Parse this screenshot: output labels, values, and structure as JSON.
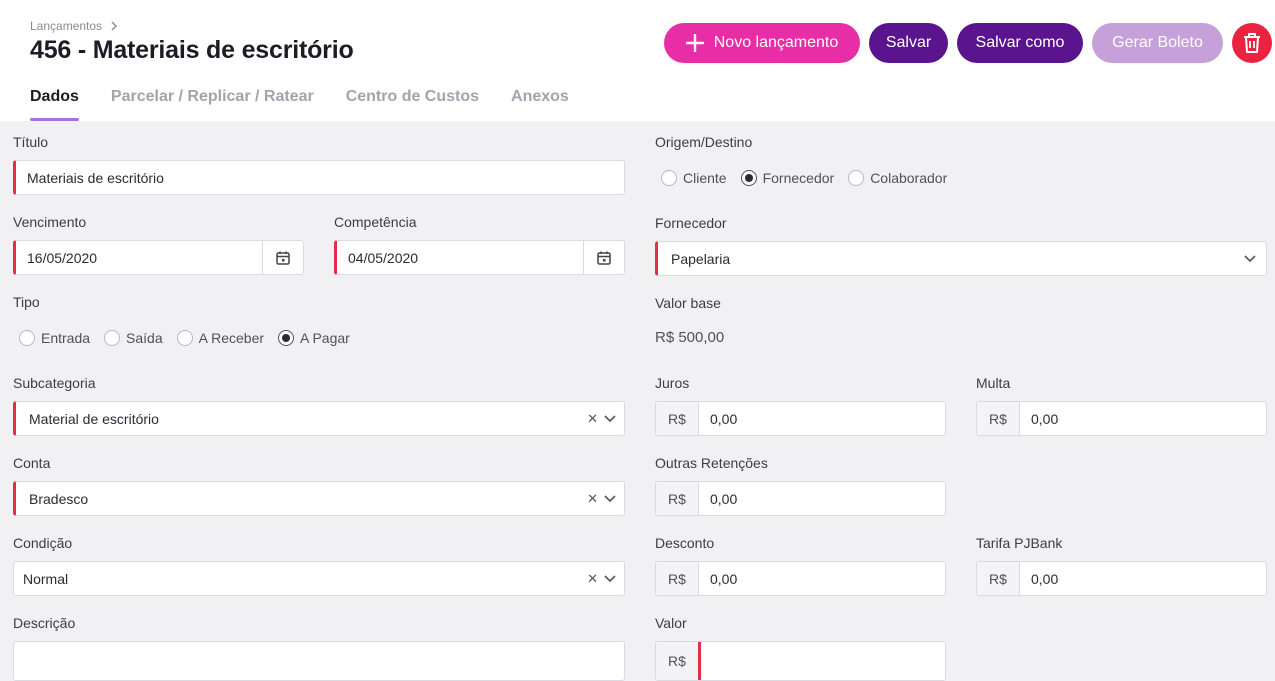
{
  "header": {
    "breadcrumb": "Lançamentos",
    "title": "456 - Materiais de escritório"
  },
  "actions": {
    "new_label": "Novo lançamento",
    "save_label": "Salvar",
    "save_as_label": "Salvar como",
    "boleto_label": "Gerar Boleto"
  },
  "tabs": [
    "Dados",
    "Parcelar / Replicar / Ratear",
    "Centro de Custos",
    "Anexos"
  ],
  "form": {
    "titulo": {
      "label": "Título",
      "value": "Materiais de escritório"
    },
    "vencimento": {
      "label": "Vencimento",
      "value": "16/05/2020"
    },
    "competencia": {
      "label": "Competência",
      "value": "04/05/2020"
    },
    "tipo": {
      "label": "Tipo",
      "options": [
        "Entrada",
        "Saída",
        "A Receber",
        "A Pagar"
      ],
      "selected": "A Pagar"
    },
    "subcategoria": {
      "label": "Subcategoria",
      "value": "Material de escritório"
    },
    "conta": {
      "label": "Conta",
      "value": "Bradesco"
    },
    "condicao": {
      "label": "Condição",
      "value": "Normal"
    },
    "descricao": {
      "label": "Descrição"
    },
    "origem": {
      "label": "Origem/Destino",
      "options": [
        "Cliente",
        "Fornecedor",
        "Colaborador"
      ],
      "selected": "Fornecedor"
    },
    "fornecedor": {
      "label": "Fornecedor",
      "value": "Papelaria"
    },
    "valor_base": {
      "label": "Valor base",
      "value": "R$ 500,00"
    },
    "currency_prefix": "R$",
    "juros": {
      "label": "Juros",
      "value": "0,00"
    },
    "multa": {
      "label": "Multa",
      "value": "0,00"
    },
    "outras_retencoes": {
      "label": "Outras Retenções",
      "value": "0,00"
    },
    "desconto": {
      "label": "Desconto",
      "value": "0,00"
    },
    "tarifa": {
      "label": "Tarifa PJBank",
      "value": "0,00"
    },
    "valor": {
      "label": "Valor"
    }
  },
  "colors": {
    "primary_pink": "#e82ea6",
    "primary_purple": "#5a158e",
    "disabled_purple": "#c6a0d8",
    "danger_red": "#ec2340",
    "required_red": "#e62d47",
    "tab_indicator": "#a772e0"
  },
  "icons": [
    "chevron-right-icon",
    "plus-icon",
    "trash-icon",
    "calendar-icon",
    "clear-x-icon",
    "chevron-down-icon"
  ]
}
